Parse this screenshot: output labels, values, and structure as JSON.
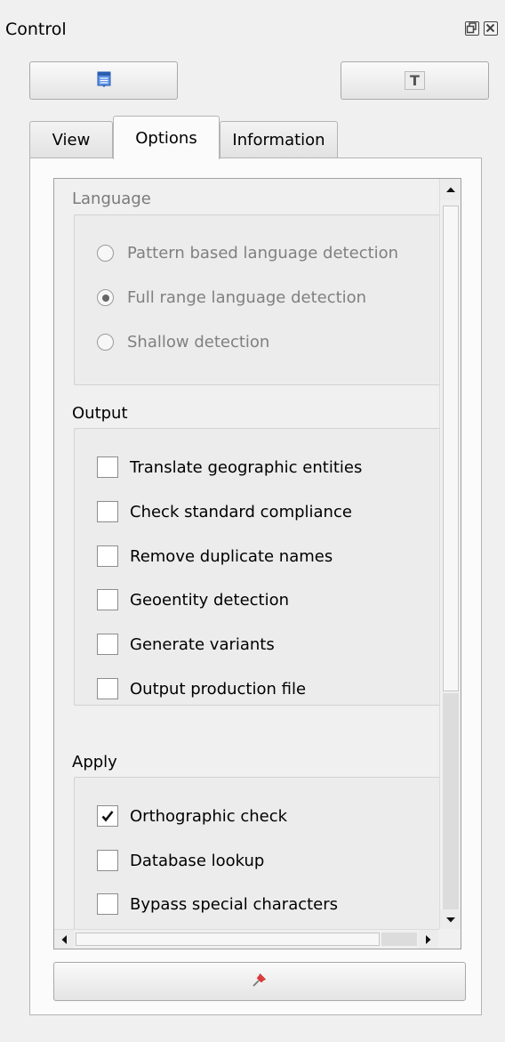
{
  "window": {
    "title": "Control",
    "float_icon": "float-window-icon",
    "close_icon": "close-window-icon"
  },
  "toolbar": {
    "left_icon": "document-list-icon",
    "right_icon": "text-T-icon",
    "right_label": "T"
  },
  "tabs": [
    {
      "label": "View",
      "active": false
    },
    {
      "label": "Options",
      "active": true
    },
    {
      "label": "Information",
      "active": false
    }
  ],
  "language": {
    "title": "Language",
    "enabled": false,
    "options": [
      {
        "label": "Pattern based language detection",
        "checked": false
      },
      {
        "label": "Full range language detection",
        "checked": true
      },
      {
        "label": "Shallow detection",
        "checked": false
      }
    ]
  },
  "output": {
    "title": "Output",
    "options": [
      {
        "label": "Translate geographic entities",
        "checked": false
      },
      {
        "label": "Check standard compliance",
        "checked": false
      },
      {
        "label": "Remove duplicate names",
        "checked": false
      },
      {
        "label": "Geoentity detection",
        "checked": false
      },
      {
        "label": "Generate variants",
        "checked": false
      },
      {
        "label": "Output production file",
        "checked": false
      }
    ]
  },
  "apply": {
    "title": "Apply",
    "options": [
      {
        "label": "Orthographic check",
        "checked": true
      },
      {
        "label": "Database lookup",
        "checked": false
      },
      {
        "label": "Bypass special characters",
        "checked": false
      }
    ]
  },
  "bottom_button": {
    "icon": "pin-icon"
  },
  "colors": {
    "pin": "#e03030",
    "doc_icon": "#3a7bd5"
  }
}
